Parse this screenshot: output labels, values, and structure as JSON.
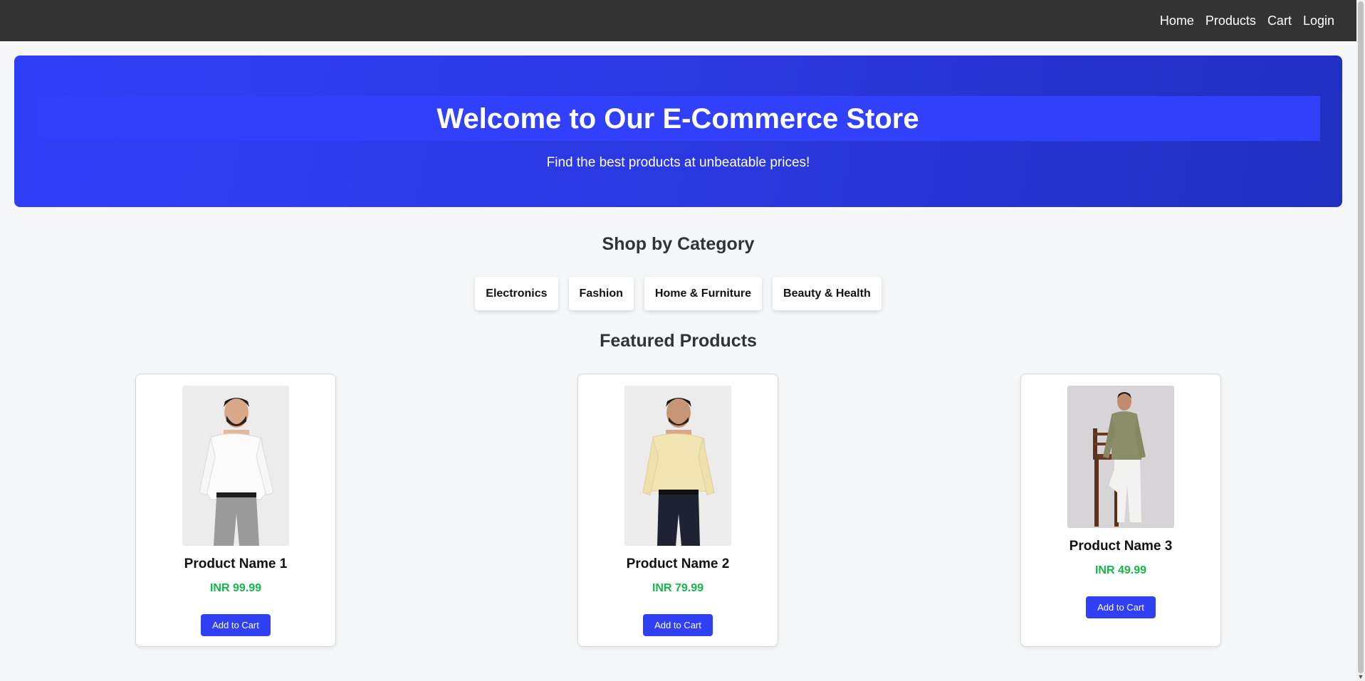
{
  "nav": {
    "links": [
      "Home",
      "Products",
      "Cart",
      "Login"
    ]
  },
  "hero": {
    "title": "Welcome to Our E-Commerce Store",
    "subtitle": "Find the best products at unbeatable prices!"
  },
  "categories_section": {
    "title": "Shop by Category",
    "items": [
      "Electronics",
      "Fashion",
      "Home & Furniture",
      "Beauty & Health"
    ]
  },
  "featured_section": {
    "title": "Featured Products",
    "products": [
      {
        "name": "Product Name 1",
        "price": "INR 99.99",
        "button": "Add to Cart",
        "image": "man-white-shirt-grey-trousers"
      },
      {
        "name": "Product Name 2",
        "price": "INR 79.99",
        "button": "Add to Cart",
        "image": "man-cream-shirt-navy-trousers"
      },
      {
        "name": "Product Name 3",
        "price": "INR 49.99",
        "button": "Add to Cart",
        "image": "man-olive-shirt-white-trousers-chair"
      }
    ]
  },
  "colors": {
    "navbar": "#333333",
    "hero": "#3040f8",
    "accent_button": "#3040f5",
    "price": "#14b84a"
  }
}
